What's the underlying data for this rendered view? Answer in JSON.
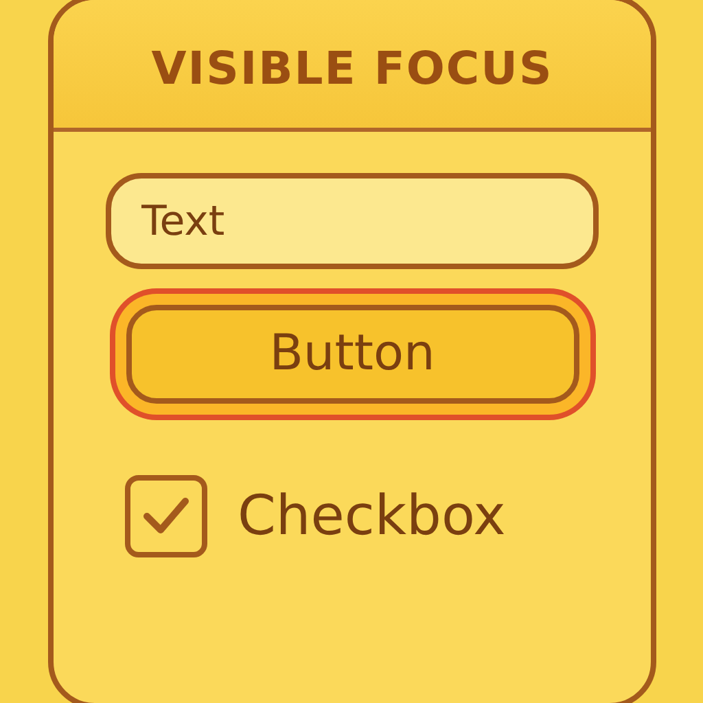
{
  "title": "VISIBLE FOCUS",
  "text_field": {
    "value": "Text"
  },
  "button": {
    "label": "Button",
    "focused": true
  },
  "checkbox": {
    "label": "Checkbox",
    "checked": true
  }
}
